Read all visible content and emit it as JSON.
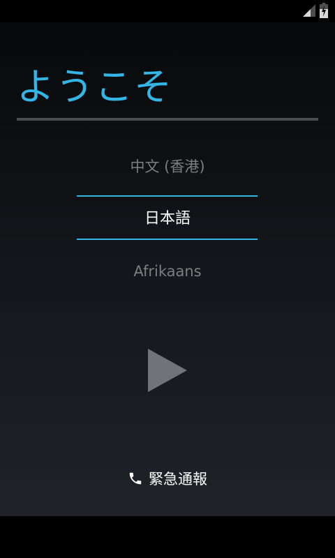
{
  "status_bar": {
    "signal_icon": "signal-icon",
    "battery_icon": "battery-charging-icon"
  },
  "welcome": {
    "title": "ようこそ"
  },
  "language_picker": {
    "previous": "中文 (香港)",
    "selected": "日本語",
    "next": "Afrikaans"
  },
  "start_button": {
    "icon": "play-icon"
  },
  "emergency": {
    "icon": "phone-icon",
    "label": "緊急通報"
  },
  "colors": {
    "accent": "#33b5e5",
    "divider": "#4a4d50",
    "dim_text": "#7c7f82",
    "text": "#ffffff"
  }
}
